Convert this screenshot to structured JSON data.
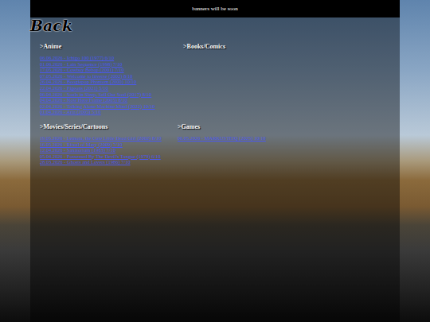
{
  "banner": "banners will be soon",
  "back": "Back",
  "sections": [
    {
      "title": ">Anime",
      "items": [
        "06.06.2026 - Ichigo 100 (1977) 6/10",
        "01.06.2026 - Lain Sequence (1998) 7/10",
        "17.05.2026 - Cowboy Bebop (2001) 7/10",
        "07.05.2026 - Welcome to Inverse (2002) 8/10",
        "26.04.2026 - Boogiepop Phantom (2000) 10/10",
        "22.04.2026 - Pigeons (2021) 5/10",
        "06.04.2026 - Souls in Sleep, Sell Our Soul (2017) 8/10",
        "04.04.2026 - Now Here Frame (2005) 8/10",
        "02.04.2026 - Talking Alone Machine Mind (2022) 10/10",
        "01.04.2026 - Aria (2005) 5/10"
      ]
    },
    {
      "title": ">Books/Comics",
      "items": []
    },
    {
      "title": ">Movies/Series/Cartoons",
      "items": [
        "19.05.2026 - Lemora, the Cute Little Dead Girl (2002) 8/10",
        "16.05.2026 - Ritual of Mary (2009) 7/10",
        "12.04.2026 - Sanatorium (1983) 7/10",
        "05.04.2026 - Possessed By The Devil's Tongue (1979) 6/10",
        "28.03.2026 - Ghosts and Lovers (1986) 7/10"
      ]
    },
    {
      "title": ">Games",
      "items": [
        "06.05.2026 - MARKUSTEIQ (2025) 10/10"
      ]
    }
  ]
}
